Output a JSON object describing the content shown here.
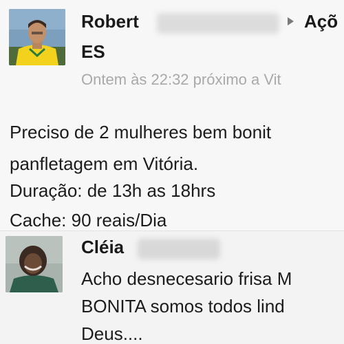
{
  "post": {
    "author_first_name": "Robert",
    "target_name": "Açõ",
    "target_line2": "ES",
    "timestamp": "Ontem às 22:32 próximo a Vit",
    "body_lines": [
      "Preciso de 2 mulheres bem bonit",
      "panfletagem em Vitória.",
      "Duração: de 13h as 18hrs",
      "Cache: 90 reais/Dia"
    ],
    "arrow_icon": "right-triangle-icon"
  },
  "comment": {
    "author_first_name": "Cléia",
    "body_lines": [
      "Acho desnecesario frisa M",
      "BONITA somos todos lind",
      "Deus...."
    ]
  },
  "colors": {
    "background": "#f6f6f6",
    "name_text": "#1a1a1a",
    "body_text": "#1c1c1c",
    "timestamp_text": "#a9a9a9"
  }
}
